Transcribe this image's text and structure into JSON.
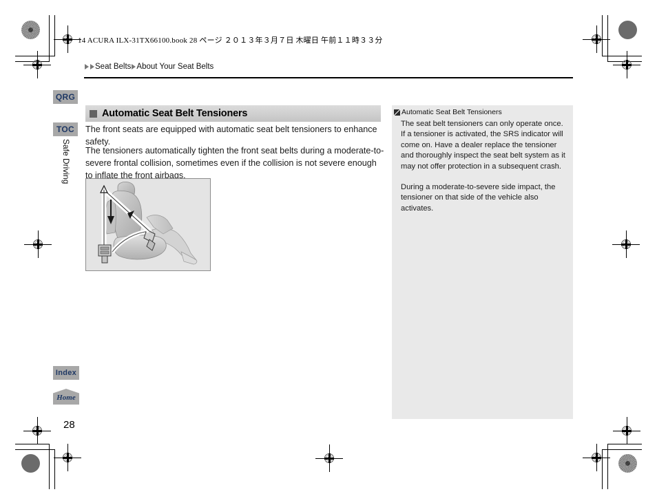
{
  "document": {
    "file_info": "14 ACURA ILX-31TX66100.book   28 ページ   ２０１３年３月７日   木曜日   午前１１時３３分",
    "page_number": "28"
  },
  "breadcrumb": {
    "level1": "Seat Belts",
    "level2": "About Your Seat Belts"
  },
  "sidebar": {
    "qrg_label": "QRG",
    "toc_label": "TOC",
    "section_label": "Safe Driving",
    "index_label": "Index",
    "home_label": "Home"
  },
  "main": {
    "section_title": "Automatic Seat Belt Tensioners",
    "paragraph_1": "The front seats are equipped with automatic seat belt tensioners to enhance safety.",
    "paragraph_2": "The tensioners automatically tighten the front seat belts during a moderate-to-severe frontal collision, sometimes even if the collision is not severe enough to inflate the front airbags.",
    "figure_caption": "Illustration of a front seat with automatic seat belt tensioner and occupant"
  },
  "note": {
    "heading": "Automatic Seat Belt Tensioners",
    "paragraph_1": "The seat belt tensioners can only operate once. If a tensioner is activated, the SRS indicator will come on. Have a dealer replace the tensioner and thoroughly inspect the seat belt system as it may not offer protection in a subsequent crash.",
    "paragraph_2": "During a moderate-to-severe side impact, the tensioner on that side of the vehicle also activates."
  },
  "colors": {
    "tab_background": "#a8a8a8",
    "tab_text": "#1f3864",
    "heading_bar": "#cfcfcf",
    "note_panel": "#e9e9e9",
    "figure_background": "#e4e4e4"
  }
}
